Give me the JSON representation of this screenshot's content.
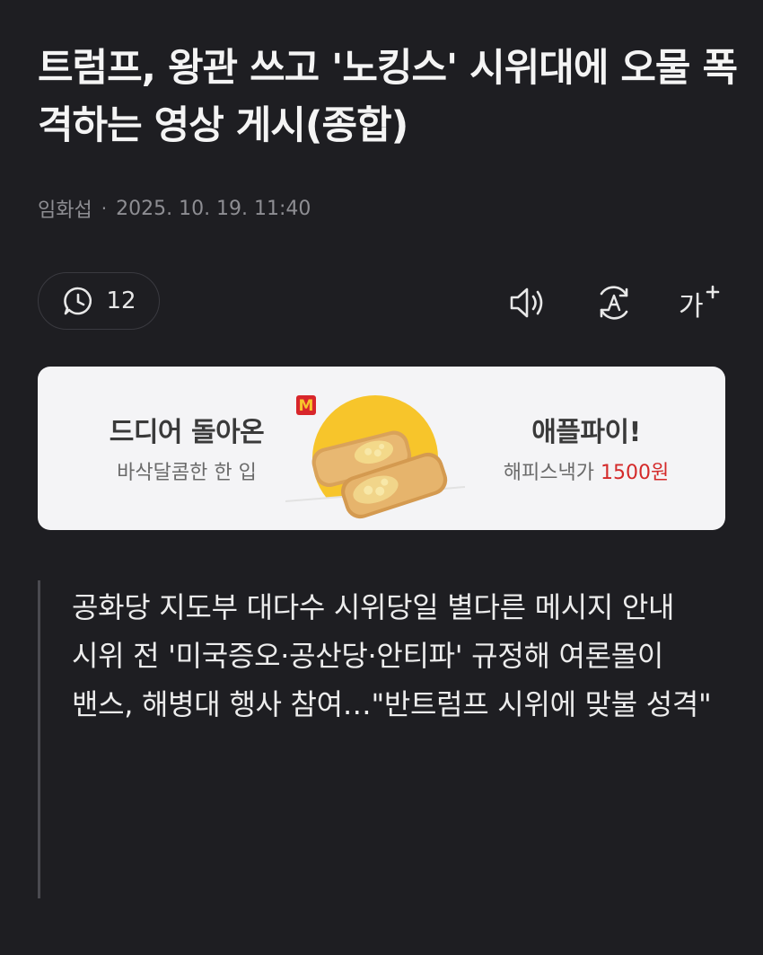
{
  "article": {
    "title": "트럼프, 왕관 쓰고 '노킹스' 시위대에 오물 폭격하는 영상 게시(종합)",
    "author": "임화섭",
    "separator": "·",
    "date": "2025. 10. 19. 11:40"
  },
  "toolbar": {
    "comment_count": "12",
    "icons": [
      "comment-icon",
      "speaker-icon",
      "translate-icon",
      "font-size-icon"
    ],
    "font_size_label": "가"
  },
  "ad": {
    "left_title": "드디어 돌아온",
    "left_subtitle": "바삭달콤한 한 입",
    "right_title": "애플파이!",
    "right_subtitle_prefix": "해피스낵가",
    "right_price": "1500원",
    "brand_mark": "M",
    "colors": {
      "background": "#f4f4f6",
      "price": "#d42a2a",
      "sun": "#f7c52b",
      "brand": "#d8262b"
    }
  },
  "summary": {
    "lines": "공화당 지도부 대다수 시위당일 별다른 메시지 안내\n시위 전 '미국증오·공산당·안티파' 규정해 여론몰이\n밴스, 해병대 행사 참여…\"반트럼프 시위에 맞불 성격\""
  },
  "colors": {
    "page_background": "#1e1e22",
    "text": "#f4f4f4",
    "meta_text": "#8e8e93"
  }
}
